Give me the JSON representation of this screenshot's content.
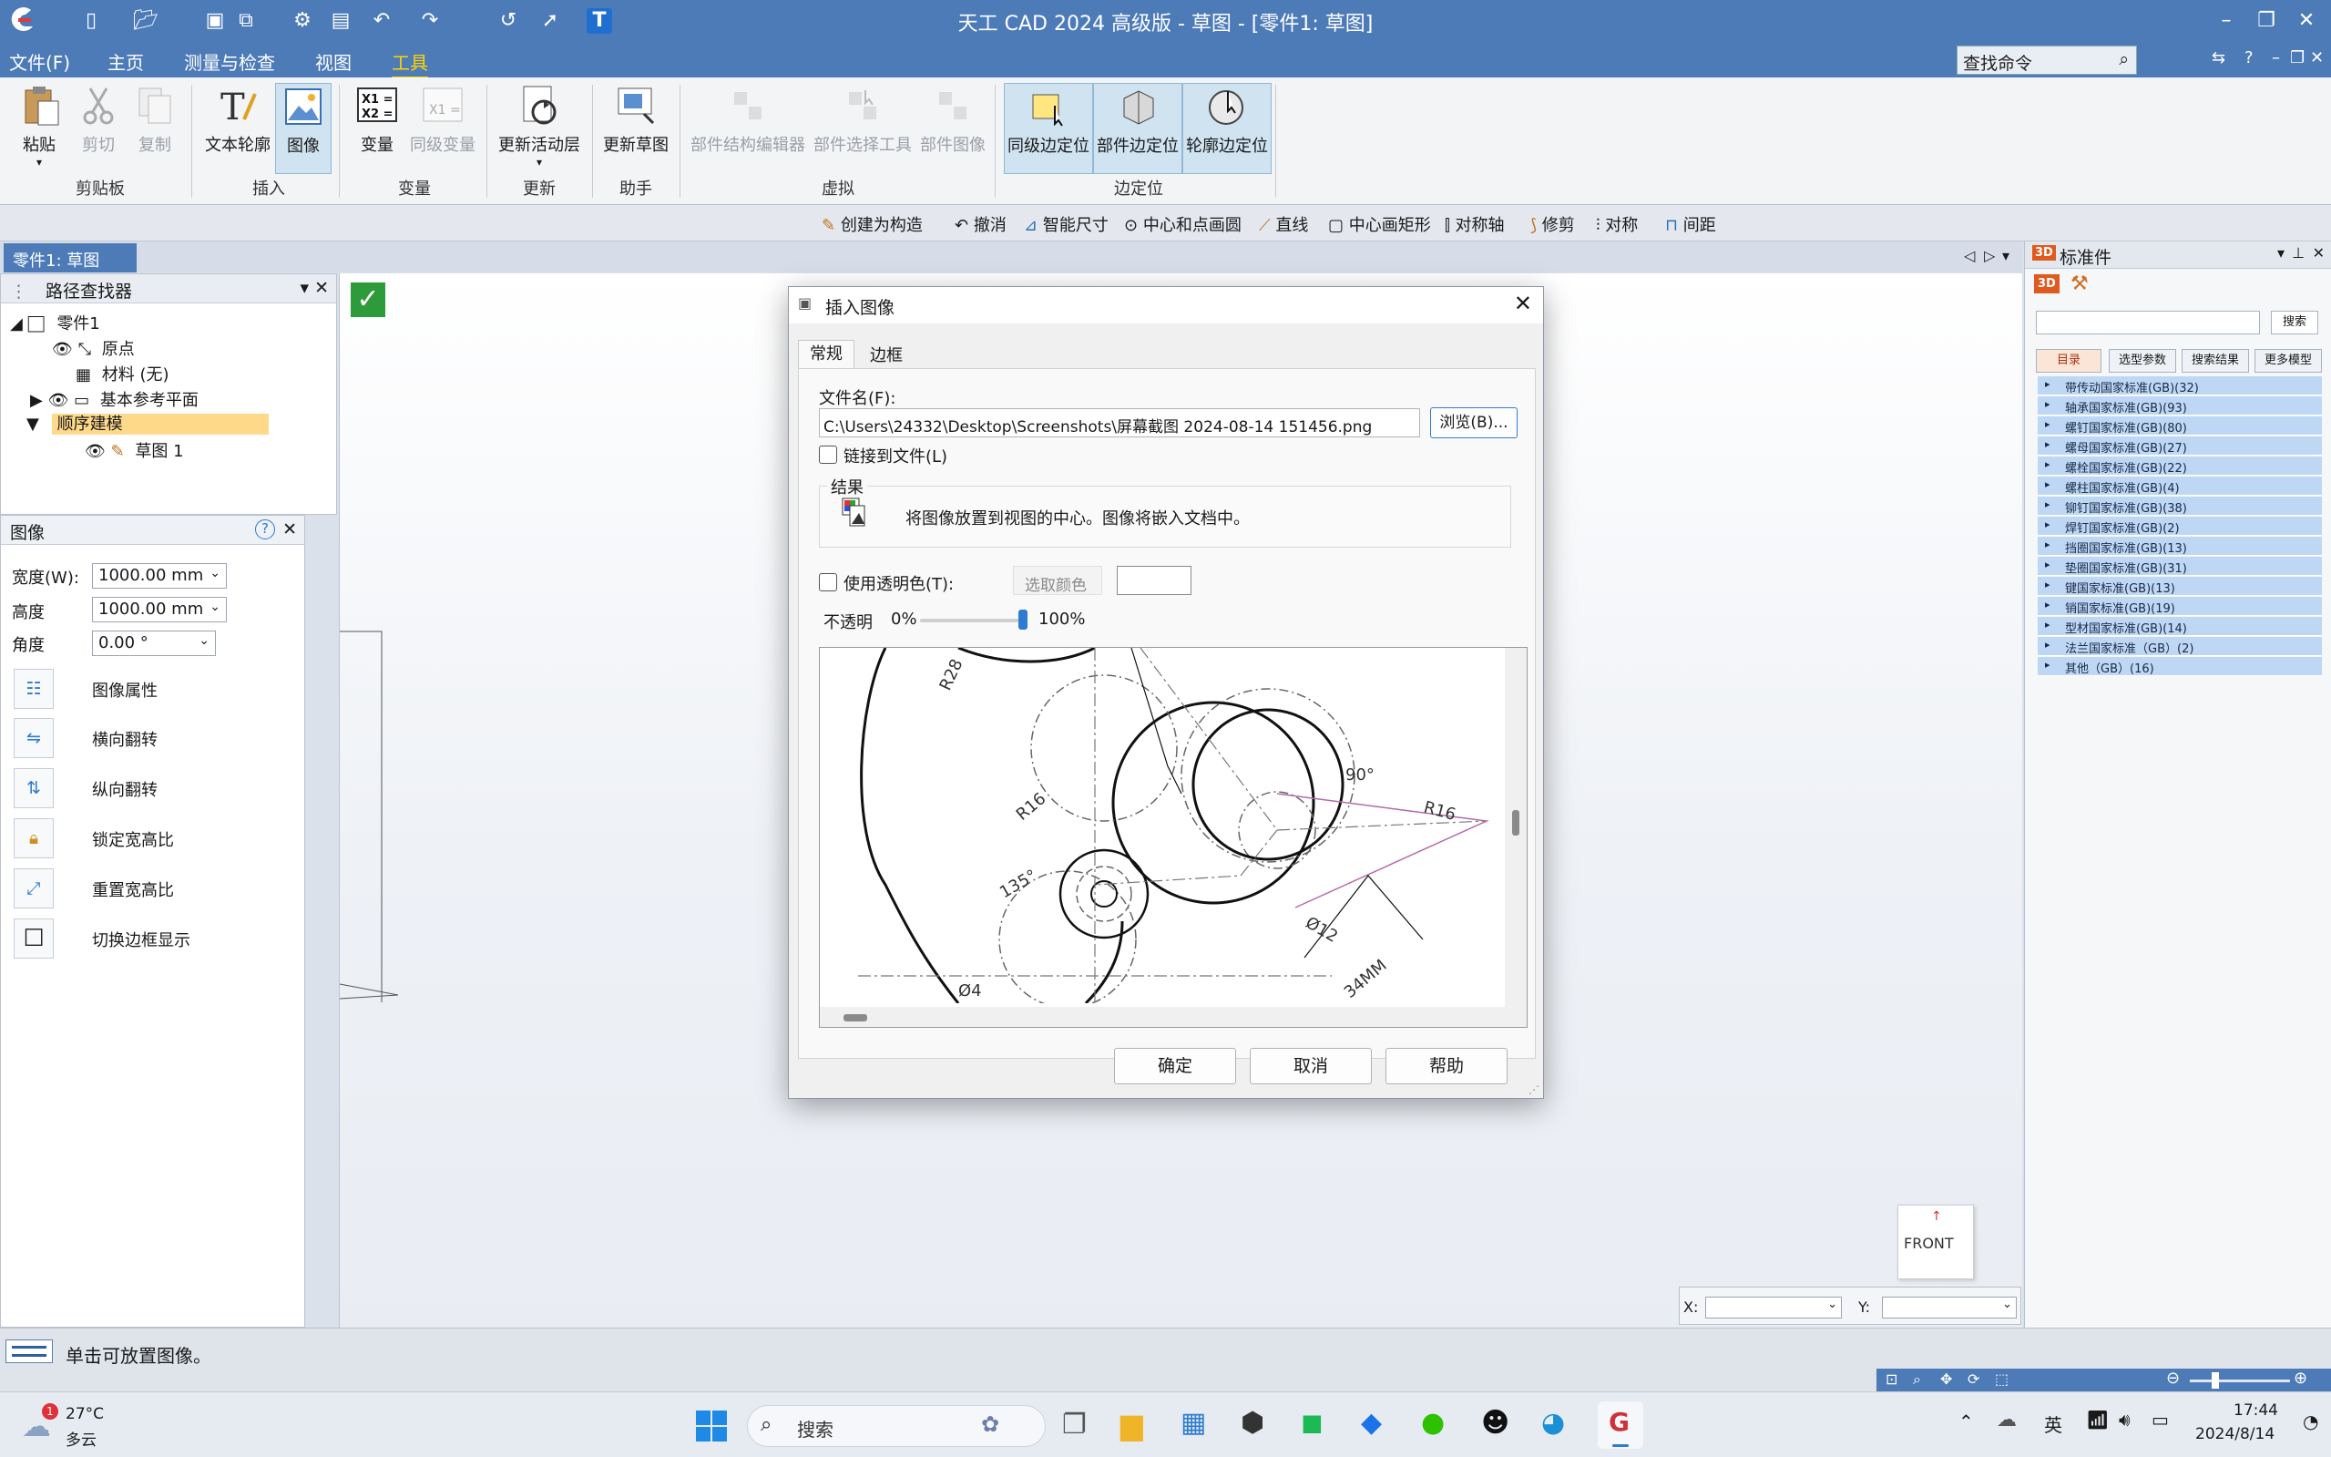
{
  "app": {
    "title": "天工 CAD 2024 高级版 - 草图 - [零件1: 草图]",
    "logo_icon": "app-logo-icon"
  },
  "menu": {
    "items": [
      "文件(F)",
      "主页",
      "测量与检查",
      "视图",
      "工具"
    ],
    "active_index": 4,
    "search_placeholder": "查找命令"
  },
  "ribbon": {
    "paste": "粘贴",
    "cut": "剪切",
    "copy": "复制",
    "clipboard_group": "剪贴板",
    "text_profile": "文本轮廓",
    "image": "图像",
    "insert_group": "插入",
    "variable": "变量",
    "same_level_variable": "同级变量",
    "variable_group": "变量",
    "update_active_layer": "更新活动层",
    "update_group": "更新",
    "update_sketch": "更新草图",
    "assistant_group": "助手",
    "part_structure_editor": "部件结构编辑器",
    "part_selection_tool": "部件选择工具",
    "part_image": "部件图像",
    "virtual_group": "虚拟",
    "same_level_edge_locate": "同级边定位",
    "part_edge_locate": "部件边定位",
    "profile_edge_locate": "轮廓边定位",
    "edge_locate_group": "边定位"
  },
  "sketch_toolbar": {
    "create_as_construction": "创建为构造",
    "undo": "撤消",
    "smart_dimension": "智能尺寸",
    "center_point_circle": "中心和点画圆",
    "line": "直线",
    "center_rectangle": "中心画矩形",
    "symmetry_axis": "对称轴",
    "trim": "修剪",
    "symmetric": "对称",
    "spacing": "间距"
  },
  "doc_tab": {
    "label": "零件1: 草图"
  },
  "path_finder": {
    "title": "路径查找器",
    "part": "零件1",
    "origin": "原点",
    "material": "材料 (无)",
    "base_planes": "基本参考平面",
    "ordered_modeling": "顺序建模",
    "sketch1": "草图 1"
  },
  "image_panel": {
    "title": "图像",
    "width_label": "宽度(W):",
    "width_value": "1000.00 mm",
    "height_label": "高度",
    "height_value": "1000.00 mm",
    "angle_label": "角度",
    "angle_value": "0.00 °",
    "actions": [
      "图像属性",
      "横向翻转",
      "纵向翻转",
      "锁定宽高比",
      "重置宽高比",
      "切换边框显示"
    ]
  },
  "dialog": {
    "title": "插入图像",
    "tabs": [
      "常规",
      "边框"
    ],
    "file_label": "文件名(F):",
    "file_path": "C:\\Users\\24332\\Desktop\\Screenshots\\屏幕截图 2024-08-14 151456.png",
    "browse": "浏览(B)...",
    "link_to_file": "链接到文件(L)",
    "result_label": "结果",
    "result_text": "将图像放置到视图的中心。图像将嵌入文档中。",
    "use_transparent": "使用透明色(T):",
    "pick_color": "选取颜色",
    "opacity_label": "不透明",
    "opacity_min": "0%",
    "opacity_max": "100%",
    "opacity_value": 1.0,
    "ok": "确定",
    "cancel": "取消",
    "help": "帮助",
    "preview_labels": [
      "R28",
      "R16",
      "90°",
      "R16",
      "135°",
      "Ø12",
      "Ø4",
      "34MM"
    ]
  },
  "standard_parts": {
    "title": "标准件",
    "search_button": "搜索",
    "tabs": [
      "目录",
      "选型参数",
      "搜索结果",
      "更多模型"
    ],
    "items": [
      "带传动国家标准(GB)(32)",
      "轴承国家标准(GB)(93)",
      "螺钉国家标准(GB)(80)",
      "螺母国家标准(GB)(27)",
      "螺栓国家标准(GB)(22)",
      "螺柱国家标准(GB)(4)",
      "铆钉国家标准(GB)(38)",
      "焊钉国家标准(GB)(2)",
      "挡圈国家标准(GB)(13)",
      "垫圈国家标准(GB)(31)",
      "键国家标准(GB)(13)",
      "销国家标准(GB)(19)",
      "型材国家标准(GB)(14)",
      "法兰国家标准（GB）(2)",
      "其他（GB）(16)"
    ]
  },
  "view_cube": {
    "label": "FRONT"
  },
  "coords": {
    "x_label": "X:",
    "y_label": "Y:"
  },
  "status": {
    "message": "单击可放置图像。"
  },
  "taskbar": {
    "weather_temp": "27°C",
    "weather_text": "多云",
    "weather_badge": "1",
    "search_label": "搜索",
    "ime": "英",
    "time": "17:44",
    "date": "2024/8/14"
  },
  "colors": {
    "title_bar": "#4d7bb8",
    "active_menu": "#ffd400",
    "std_row": "#bdd7f5",
    "accent": "#2f7bd1"
  }
}
